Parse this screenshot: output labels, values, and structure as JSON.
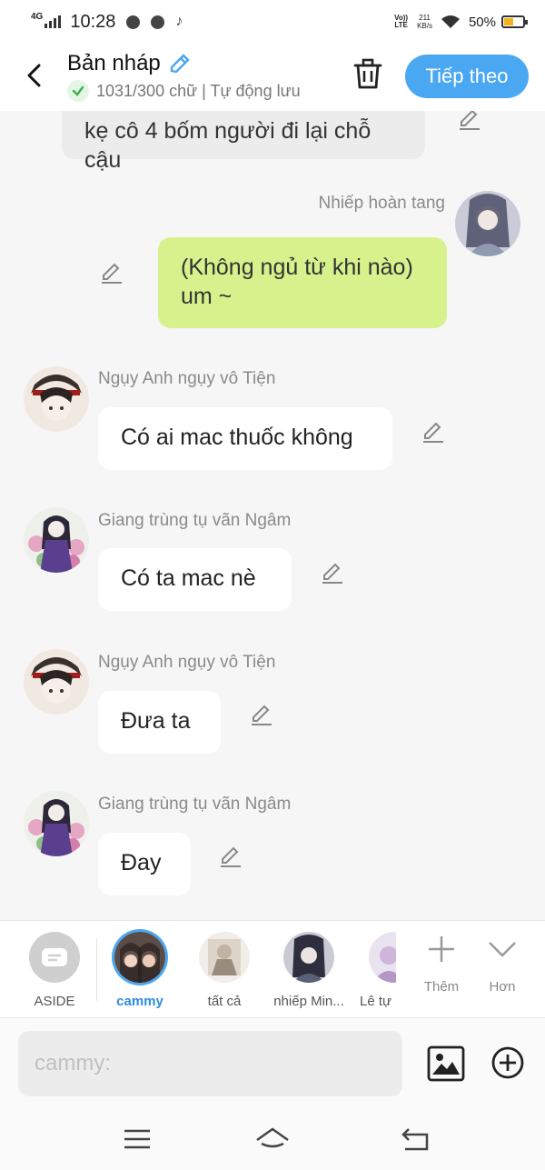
{
  "status": {
    "network": "4G",
    "time": "10:28",
    "volte_top": "Vo))",
    "volte_bottom": "LTE",
    "speed_value": "211",
    "speed_unit": "KB/s",
    "battery": "50%"
  },
  "header": {
    "title": "Bản nháp",
    "subtitle": "1031/300 chữ | Tự động lưu",
    "next_label": "Tiếp theo"
  },
  "messages": [
    {
      "side": "left",
      "sender": "",
      "text": "kẹ cô 4 bốm người đi lại chỗ cậu"
    },
    {
      "side": "right",
      "sender": "Nhiếp hoàn tang",
      "text": "(Không ngủ từ khi nào) um ~"
    },
    {
      "side": "left",
      "sender": "Ngụy Anh ngụy vô Tiện",
      "text": "Có ai mac thuốc không"
    },
    {
      "side": "left",
      "sender": "Giang trùng tụ vãn Ngâm",
      "text": "Có ta mac nè"
    },
    {
      "side": "left",
      "sender": "Ngụy Anh ngụy vô Tiện",
      "text": "Đưa ta"
    },
    {
      "side": "left",
      "sender": "Giang trùng tụ vãn Ngâm",
      "text": "Đay"
    }
  ],
  "characters": [
    {
      "label": "ASIDE"
    },
    {
      "label": "cammy"
    },
    {
      "label": "tất cả"
    },
    {
      "label": "nhiếp Min..."
    },
    {
      "label": "Lê tự"
    }
  ],
  "tools": {
    "more_label": "Thêm",
    "less_label": "Hơn"
  },
  "input": {
    "placeholder": "cammy:"
  },
  "colors": {
    "accent": "#4aa7f2",
    "own_bubble": "#d7f28c",
    "other_bubble": "#ffffff",
    "background": "#f6f6f6"
  },
  "icons": {
    "back": "chevron-left-icon",
    "edit_title": "pencil-icon",
    "autosave": "check-icon",
    "trash": "trash-icon",
    "message_edit": "pencil-icon",
    "more": "plus-icon",
    "less": "chevron-down-icon",
    "image": "image-icon",
    "add": "plus-circle-icon",
    "nav_menu": "menu-icon",
    "nav_home": "home-icon",
    "nav_back": "back-icon"
  }
}
